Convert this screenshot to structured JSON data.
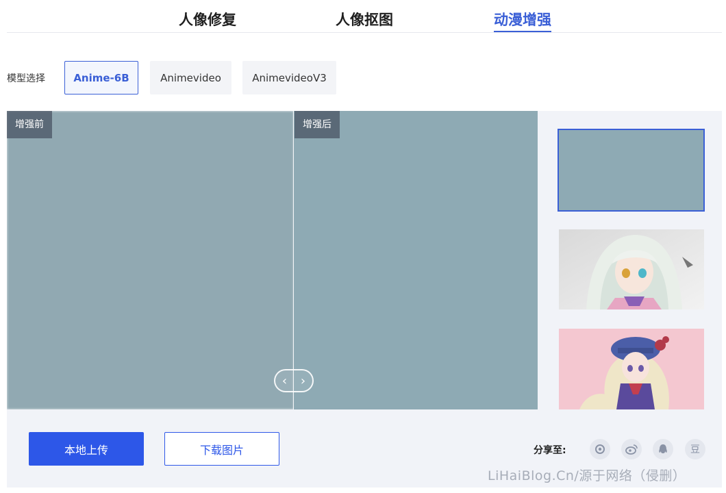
{
  "tabs": [
    {
      "label": "人像修复",
      "active": false
    },
    {
      "label": "人像抠图",
      "active": false
    },
    {
      "label": "动漫增强",
      "active": true
    }
  ],
  "model_select": {
    "label": "模型选择",
    "options": [
      "Anime-6B",
      "Animevideo",
      "AnimevideoV3"
    ],
    "selected": "Anime-6B"
  },
  "viewer": {
    "before_label": "增强前",
    "after_label": "增强后",
    "handle_left": "‹",
    "handle_right": "›"
  },
  "thumbnails": [
    {
      "name": "girl-on-water",
      "selected": true
    },
    {
      "name": "white-hair-girl",
      "selected": false
    },
    {
      "name": "blue-hat-girl",
      "selected": false
    }
  ],
  "actions": {
    "upload_label": "本地上传",
    "download_label": "下载图片"
  },
  "share": {
    "label": "分享至:",
    "icons": [
      "wechat-moments-icon",
      "weibo-icon",
      "qq-icon",
      "douban-icon"
    ],
    "douban_glyph": "豆"
  },
  "watermark": "LiHaiBlog.Cn/源于网络（侵删）",
  "colors": {
    "accent": "#2d57e8",
    "accent_text": "#3a5fd6",
    "panel_bg": "#f1f3f8"
  }
}
